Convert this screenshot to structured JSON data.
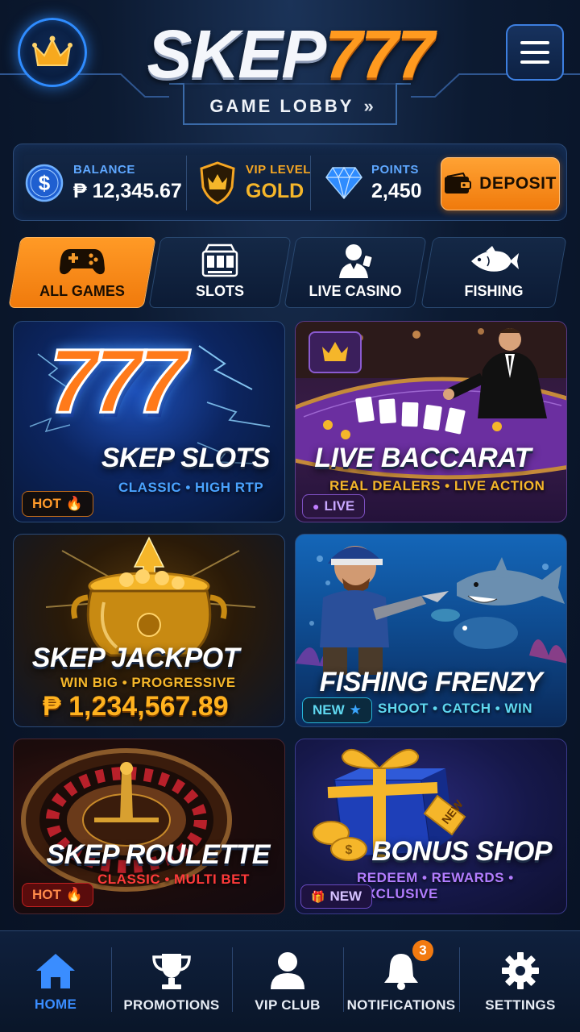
{
  "header": {
    "logo_text_white": "SKEP",
    "logo_text_orange": "777",
    "lobby_label": "GAME LOBBY",
    "lobby_chevron": "»"
  },
  "stats": {
    "balance": {
      "label": "BALANCE",
      "value": "₱ 12,345.67",
      "icon": "dollar-coin-icon"
    },
    "vip": {
      "label": "VIP LEVEL",
      "value": "GOLD",
      "icon": "crown-shield-icon"
    },
    "points": {
      "label": "POINTS",
      "value": "2,450",
      "icon": "diamond-icon"
    },
    "deposit_label": "DEPOSIT"
  },
  "categories": [
    {
      "label": "ALL GAMES",
      "icon": "gamepad-icon",
      "active": true
    },
    {
      "label": "SLOTS",
      "icon": "slot-machine-icon",
      "active": false
    },
    {
      "label": "LIVE CASINO",
      "icon": "dealer-icon",
      "active": false
    },
    {
      "label": "FISHING",
      "icon": "fish-icon",
      "active": false
    }
  ],
  "games": [
    {
      "title": "SKEP SLOTS",
      "subtitle": "CLASSIC • HIGH RTP",
      "badge": "HOT",
      "badge_icon": "🔥",
      "art_text": "777"
    },
    {
      "title": "LIVE BACCARAT",
      "subtitle": "REAL DEALERS • LIVE ACTION",
      "badge": "LIVE",
      "badge_icon": "●"
    },
    {
      "title": "SKEP JACKPOT",
      "subtitle": "WIN BIG • PROGRESSIVE",
      "jackpot": "₱ 1,234,567.89"
    },
    {
      "title": "FISHING FRENZY",
      "subtitle": "SHOOT • CATCH • WIN",
      "badge": "NEW",
      "badge_icon": "★"
    },
    {
      "title": "SKEP ROULETTE",
      "subtitle": "CLASSIC • MULTI BET",
      "badge": "HOT",
      "badge_icon": "🔥"
    },
    {
      "title": "BONUS SHOP",
      "subtitle": "REDEEM • REWARDS • EXCLUSIVE",
      "badge": "NEW",
      "badge_icon": "🎁",
      "tag_text": "NEW"
    }
  ],
  "nav": [
    {
      "label": "HOME",
      "icon": "home-icon",
      "active": true
    },
    {
      "label": "PROMOTIONS",
      "icon": "trophy-icon",
      "active": false
    },
    {
      "label": "VIP CLUB",
      "icon": "user-icon",
      "active": false
    },
    {
      "label": "NOTIFICATIONS",
      "icon": "bell-icon",
      "active": false,
      "count": "3"
    },
    {
      "label": "SETTINGS",
      "icon": "gear-icon",
      "active": false
    }
  ],
  "colors": {
    "accent_orange": "#f58a16",
    "accent_blue": "#3a8dff",
    "background": "#0c1a31",
    "gold": "#f5b62a"
  }
}
